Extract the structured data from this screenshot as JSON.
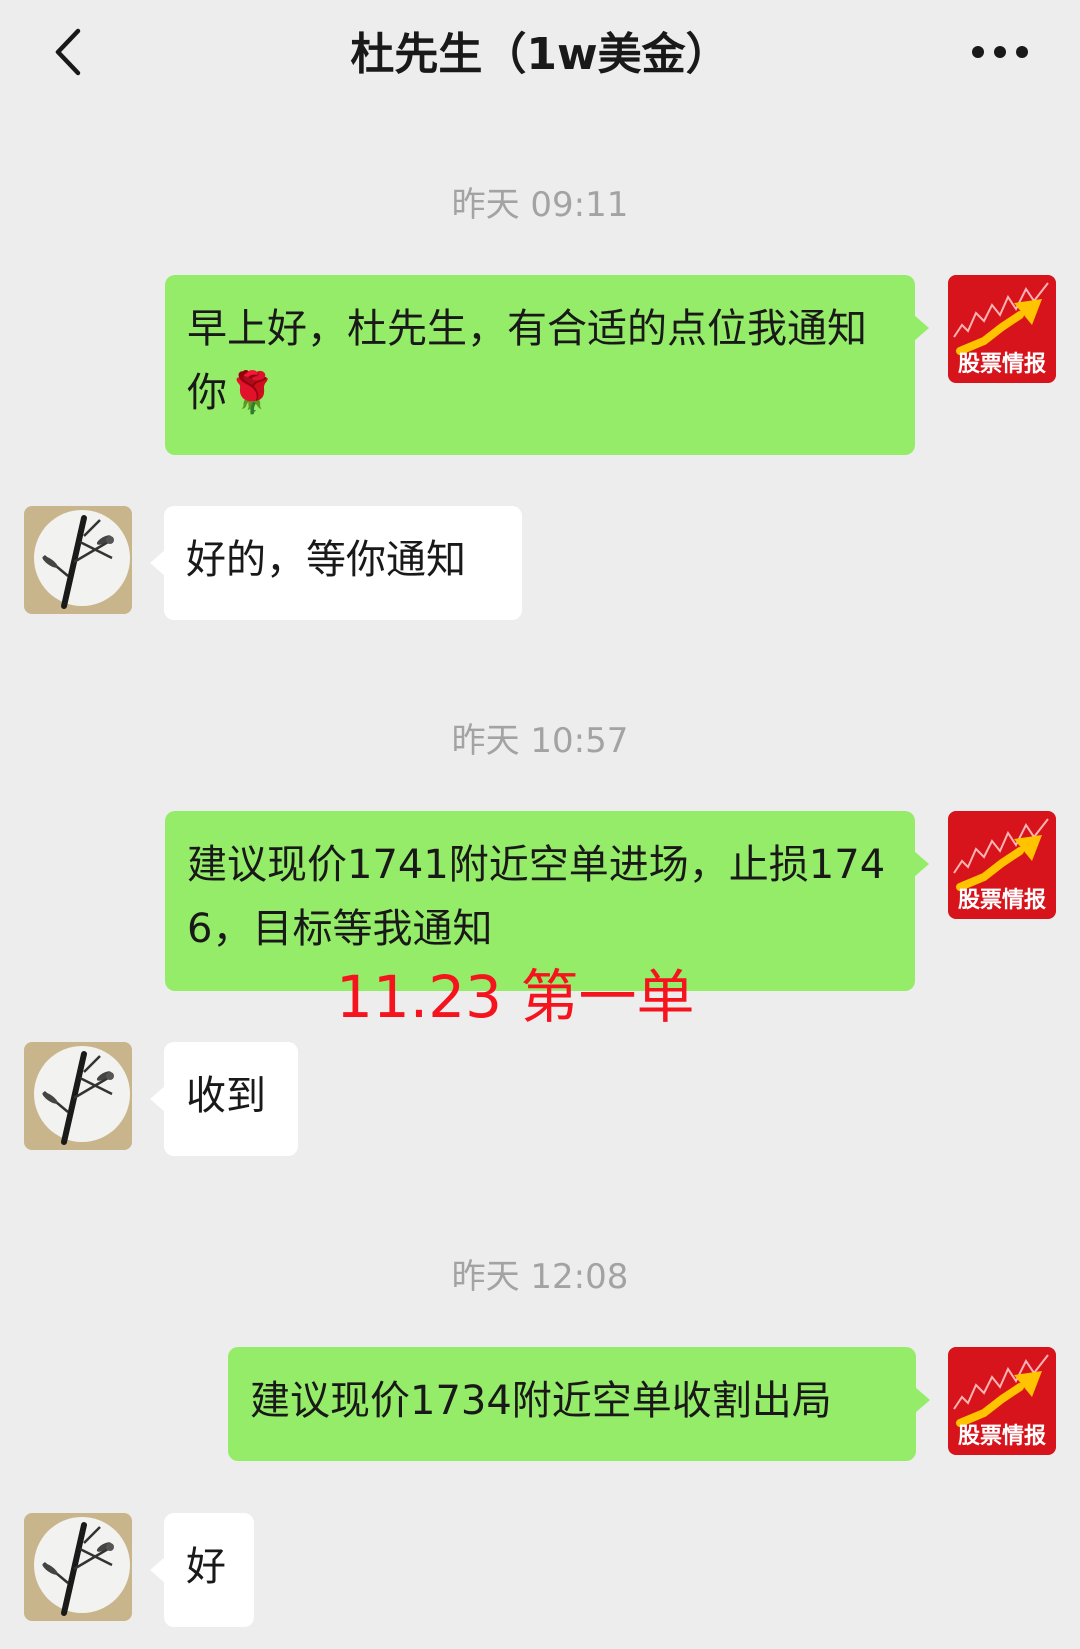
{
  "header": {
    "title": "杜先生（1w美金）"
  },
  "messages": [
    {
      "type": "time",
      "text": "昨天 09:11"
    },
    {
      "type": "sent",
      "sender": "股票情报",
      "text": "早上好，杜先生，有合适的点位我通知你🌹"
    },
    {
      "type": "received",
      "text": "好的，等你通知"
    },
    {
      "type": "time",
      "text": "昨天 10:57"
    },
    {
      "type": "sent",
      "sender": "股票情报",
      "text": "建议现价1741附近空单进场，止损1746，目标等我通知"
    },
    {
      "type": "received",
      "text": "收到"
    },
    {
      "type": "time",
      "text": "昨天 12:08"
    },
    {
      "type": "sent",
      "sender": "股票情报",
      "text": "建议现价1734附近空单收割出局"
    },
    {
      "type": "received",
      "text": "好"
    }
  ],
  "annotation": "11.23  第一单",
  "avatar_label": "股票情报",
  "colors": {
    "background": "#ededed",
    "sent_bubble": "#95ec69",
    "received_bubble": "#ffffff",
    "annotation": "#f5131e",
    "timestamp": "#a3a3a3"
  },
  "icons": {
    "back": "chevron-left-icon",
    "more": "more-dots-icon"
  }
}
